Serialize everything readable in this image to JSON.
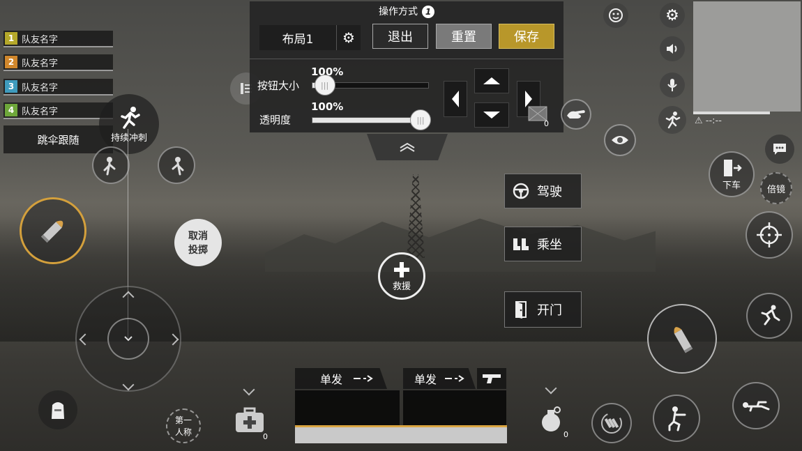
{
  "panel": {
    "title": "操作方式",
    "info_badge": "1",
    "layout_label": "布局1",
    "exit_label": "退出",
    "reset_label": "重置",
    "save_label": "保存",
    "button_size_label": "按钮大小",
    "button_size_value": "100%",
    "button_size_fraction": 0.1,
    "opacity_label": "透明度",
    "opacity_value": "100%",
    "opacity_fraction": 1.0
  },
  "teammates": [
    {
      "num": "1",
      "name": "队友名字",
      "color": "#b5a82a"
    },
    {
      "num": "2",
      "name": "队友名字",
      "color": "#d0872c"
    },
    {
      "num": "3",
      "name": "队友名字",
      "color": "#3f9bbd"
    },
    {
      "num": "4",
      "name": "队友名字",
      "color": "#6ea73a"
    }
  ],
  "left": {
    "parachute_follow": "跳伞跟随",
    "sprint_label": "持续冲刺",
    "cancel_throw_line1": "取消",
    "cancel_throw_line2": "投掷",
    "first_person_line1": "第一",
    "first_person_line2": "人称",
    "medkit_count": "0"
  },
  "center": {
    "rescue_label": "救援"
  },
  "vehicle": {
    "drive_label": "驾驶",
    "ride_label": "乘坐",
    "open_door_label": "开门"
  },
  "right": {
    "exit_vehicle_label": "下车",
    "scope_label": "倍镜",
    "grenade_count": "0",
    "crate_count": "0",
    "minimap_time": "--:--"
  },
  "weapons": {
    "slot1_mode": "单发",
    "slot2_mode": "单发"
  },
  "colors": {
    "save_button": "#b8972a",
    "reset_button": "#7a7a7a",
    "hp_line": "#d9a441",
    "fire_ring": "#d4a03c"
  }
}
